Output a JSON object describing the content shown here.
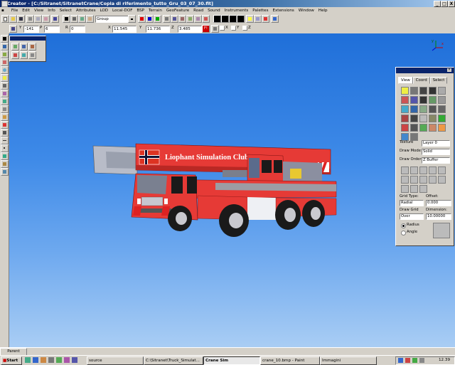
{
  "window": {
    "title": "Creator - [C:/Sitranet/SitranetCrane/Copia di riferimento_tutto_Gru_03_07_30.flt]",
    "controls": [
      "_",
      "□",
      "X"
    ]
  },
  "menu": [
    "File",
    "Edit",
    "View",
    "Info",
    "Select",
    "Attributes",
    "LOD",
    "Local-DOF",
    "BSP",
    "Terrain",
    "GeoFeature",
    "Road",
    "Sound",
    "Instruments",
    "Palettes",
    "Extensions",
    "Window",
    "Help"
  ],
  "toolbar1": {
    "group_select": "Group"
  },
  "toolbar2": {
    "y_label": "Y",
    "y_value": "-141",
    "p_label": "P",
    "p_value": "6",
    "r_label": "R",
    "r_value": "0",
    "x_coord_label": "X",
    "x_coord_value": "11.545",
    "y_coord_label": "Y",
    "y_coord_value": "11.736",
    "z_coord_label": "Z",
    "z_coord_value": "3.485",
    "f_button": "F!",
    "axis_x": "X",
    "axis_y": "Y",
    "axis_z": "Z"
  },
  "viewport": {
    "boom_text": "Liophant Simulation Club",
    "axes": {
      "x": "x",
      "y": "y"
    },
    "colors": {
      "sky_top": "#1f6fd9",
      "sky_bottom": "#a9cdf4",
      "crane_red": "#e63a36"
    }
  },
  "panel": {
    "tabs": [
      "View",
      "Coord",
      "Select"
    ],
    "texture_label": "Texture",
    "texture_value": "Layer 0",
    "draw_mode_label": "Draw Mode",
    "draw_mode_value": "Solid",
    "draw_order_label": "Draw Order",
    "draw_order_value": "Z Buffer",
    "grid_type_label": "Grid Type:",
    "grid_type_value": "Radial",
    "offset_label": "Offset:",
    "offset_value": "0.000",
    "draw_grid_label": "Draw Grid",
    "draw_grid_value": "Over",
    "dimension_label": "Dimension:",
    "dimension_value": "10.00000",
    "radius_label": "Radius",
    "angle_label": "Angle"
  },
  "bottom": {
    "parent_label": "Parent"
  },
  "taskbar": {
    "start": "Start",
    "tasks": [
      "source",
      "C:\\Sitranet\\Truck_Simulat...",
      "Crane Sim",
      "crane_10.bmp - Paint",
      "Immagini"
    ],
    "clock": "12.39"
  }
}
